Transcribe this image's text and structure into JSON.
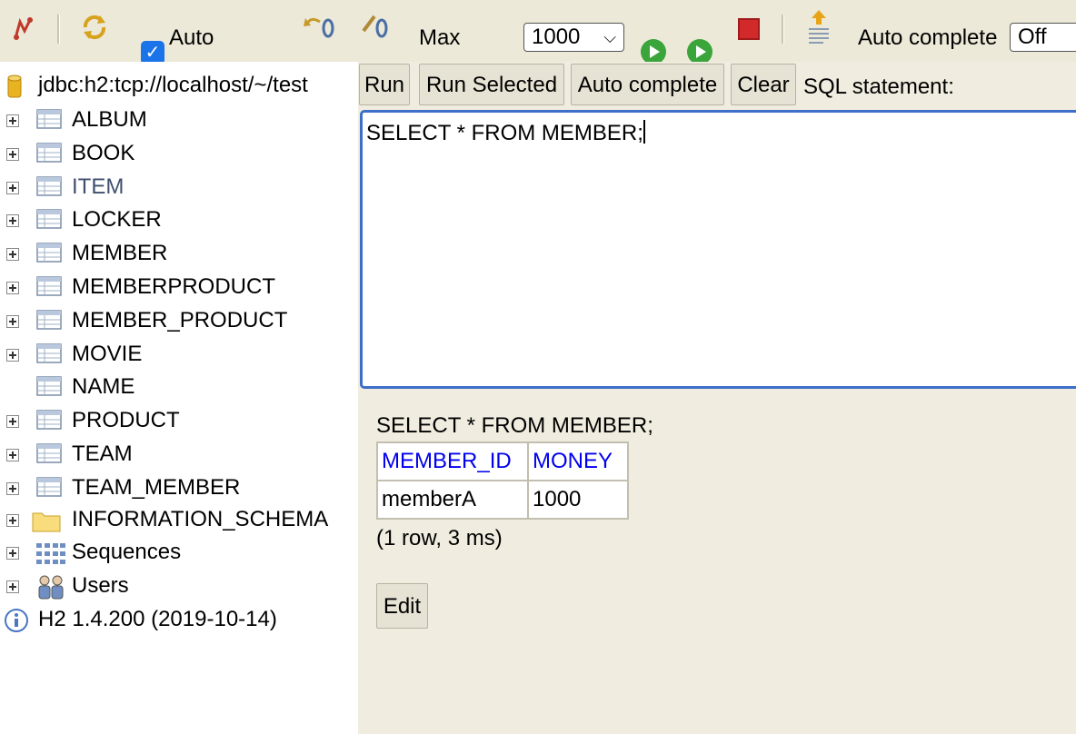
{
  "toolbar": {
    "auto_label": "Auto",
    "max_label": "Max",
    "max_value": "1000",
    "auto_complete_label": "Auto complete",
    "auto_complete_value": "Off",
    "auto_checked": true
  },
  "tree": {
    "connection": "jdbc:h2:tcp://localhost/~/test",
    "tables": [
      {
        "label": "ALBUM",
        "expandable": true
      },
      {
        "label": "BOOK",
        "expandable": true
      },
      {
        "label": "ITEM",
        "expandable": true
      },
      {
        "label": "LOCKER",
        "expandable": true
      },
      {
        "label": "MEMBER",
        "expandable": true
      },
      {
        "label": "MEMBERPRODUCT",
        "expandable": true
      },
      {
        "label": "MEMBER_PRODUCT",
        "expandable": true
      },
      {
        "label": "MOVIE",
        "expandable": true
      },
      {
        "label": "NAME",
        "expandable": false
      },
      {
        "label": "PRODUCT",
        "expandable": true
      },
      {
        "label": "TEAM",
        "expandable": true
      },
      {
        "label": "TEAM_MEMBER",
        "expandable": true
      }
    ],
    "information_schema": "INFORMATION_SCHEMA",
    "sequences": "Sequences",
    "users": "Users",
    "version": "H2 1.4.200 (2019-10-14)",
    "hover_color": "#3f4f6f"
  },
  "editor_toolbar": {
    "run": "Run",
    "run_selected": "Run Selected",
    "auto_complete": "Auto complete",
    "clear": "Clear",
    "sql_statement_label": "SQL statement:"
  },
  "editor": {
    "sql": "SELECT * FROM MEMBER;"
  },
  "result": {
    "query": "SELECT * FROM MEMBER;",
    "columns": [
      "MEMBER_ID",
      "MONEY"
    ],
    "rows": [
      [
        "memberA",
        "1000"
      ]
    ],
    "summary": "(1 row, 3 ms)",
    "edit_button": "Edit"
  }
}
